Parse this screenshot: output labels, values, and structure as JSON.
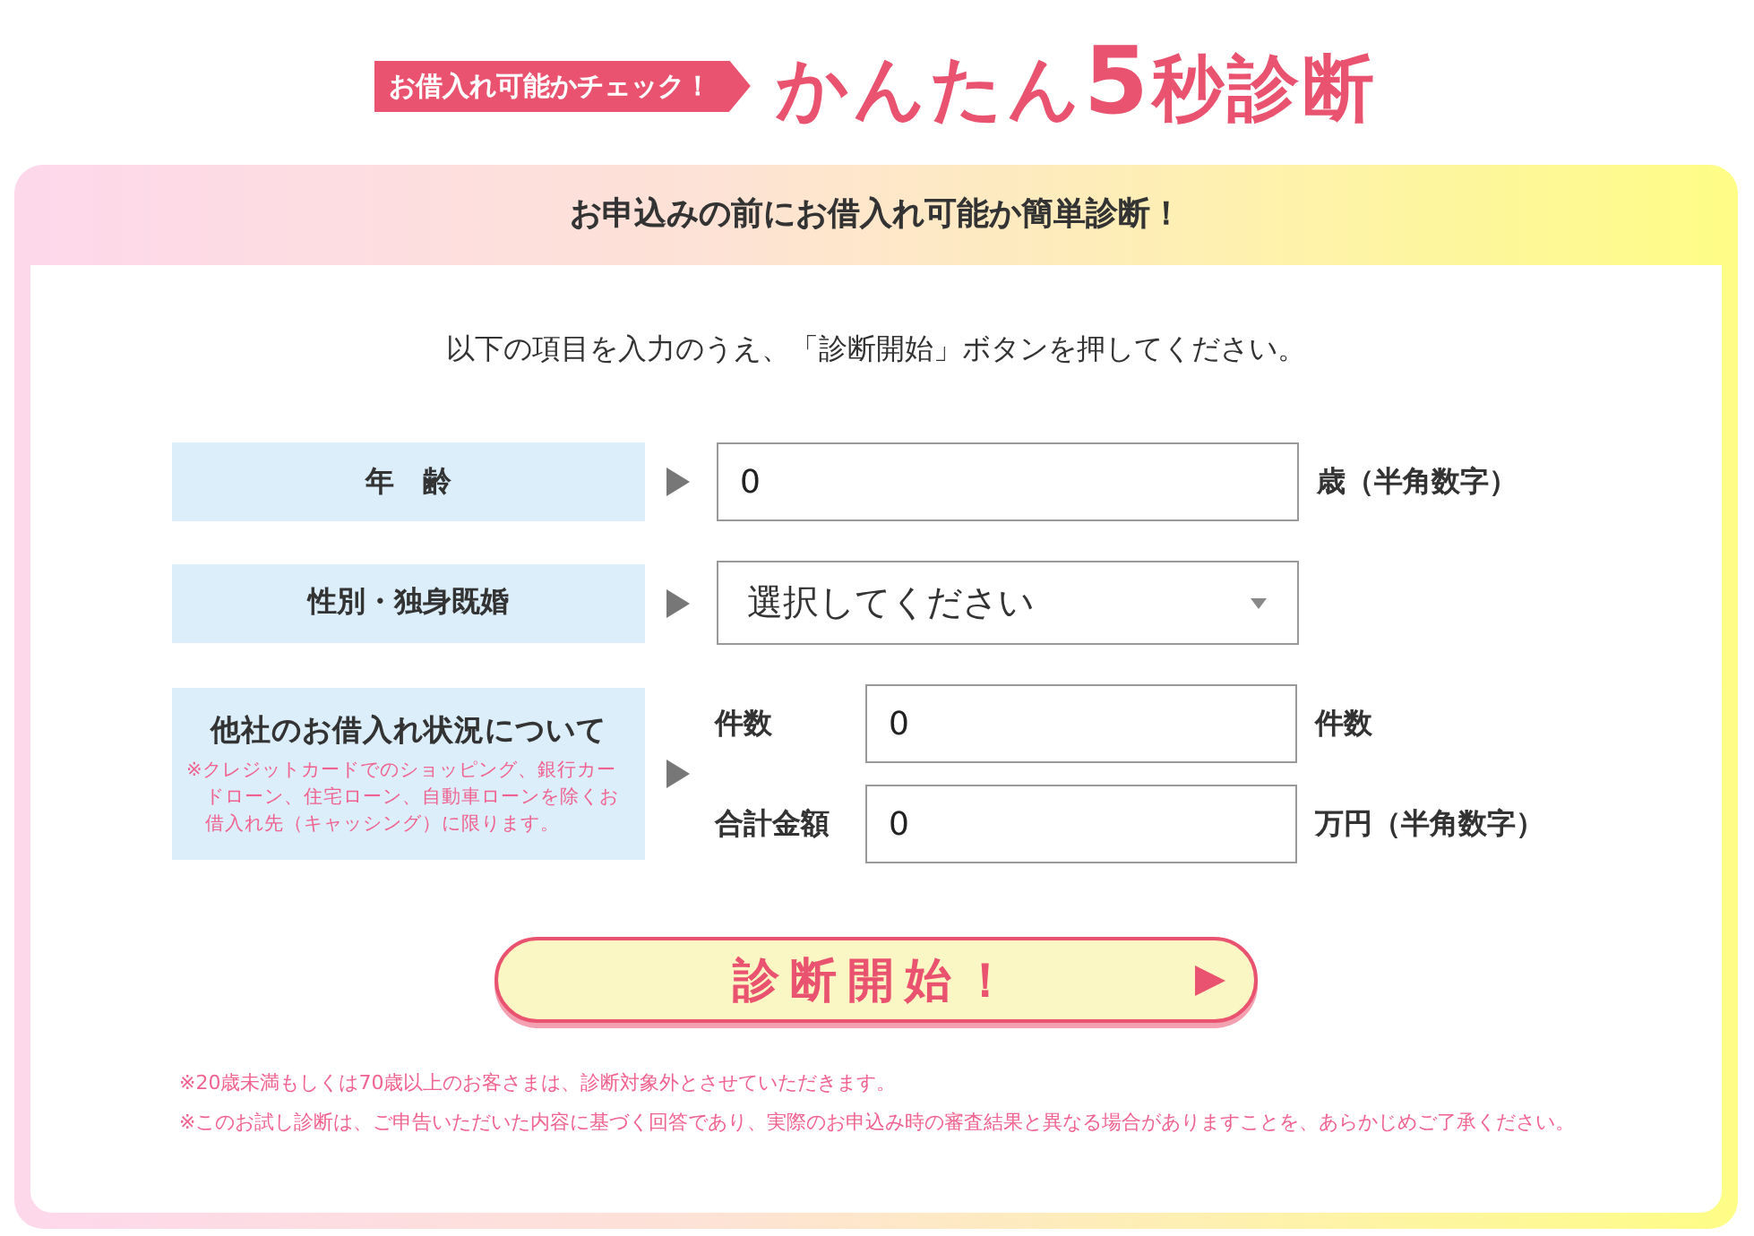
{
  "header": {
    "tag": "お借入れ可能かチェック！",
    "title": {
      "before": "かんたん",
      "number": "5",
      "after": "秒診断"
    }
  },
  "card": {
    "heading": "お申込みの前にお借入れ可能か簡単診断！",
    "intro": "以下の項目を入力のうえ、「診断開始」ボタンを押してください。"
  },
  "form": {
    "rows": [
      {
        "kind": "input",
        "label": "年　齢",
        "value": "0",
        "unit": "歳（半角数字）"
      },
      {
        "kind": "select",
        "label": "性別・独身既婚",
        "value": "選択してください"
      },
      {
        "kind": "group",
        "label": "他社のお借入れ状況について",
        "note": "※クレジットカードでのショッピング、銀行カードローン、住宅ローン、自動車ローンを除くお借入れ先（キャッシング）に限ります。",
        "fields": [
          {
            "label": "件数",
            "value": "0",
            "unit": "件数"
          },
          {
            "label": "合計金額",
            "value": "0",
            "unit": "万円（半角数字）"
          }
        ]
      }
    ]
  },
  "submit_button": {
    "label": "診断開始！"
  },
  "notes": [
    "※20歳未満もしくは70歳以上のお客さまは、診断対象外とさせていただきます。",
    "※このお試し診断は、ご申告いただいた内容に基づく回答であり、実際のお申込み時の審査結果と異なる場合がありますことを、あらかじめご了承ください。"
  ]
}
